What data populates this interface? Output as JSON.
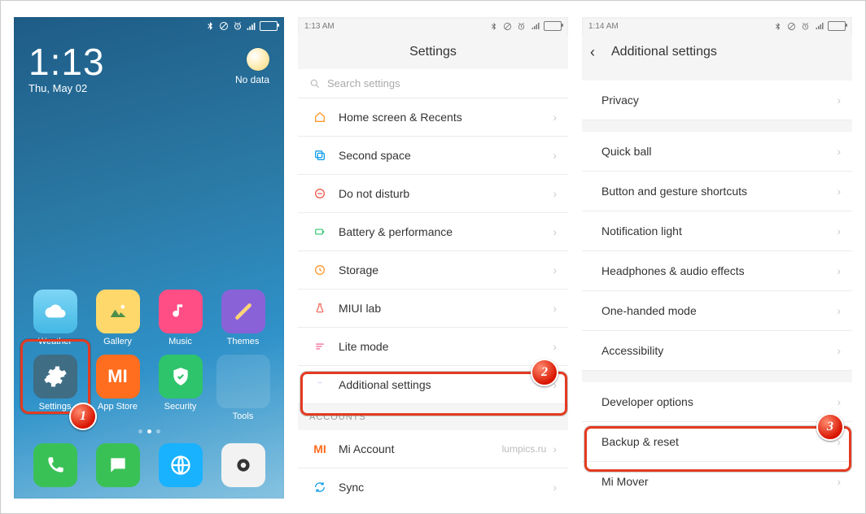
{
  "phone1": {
    "status": {
      "icons": [
        "bt",
        "dnd",
        "alarm",
        "signal",
        "battery"
      ]
    },
    "clock_time": "1:13",
    "clock_date": "Thu, May 02",
    "weather_status": "No data",
    "apps_row1": [
      {
        "name": "weather",
        "label": "Weather",
        "bg": "#56c4ec"
      },
      {
        "name": "gallery",
        "label": "Gallery",
        "bg": "#ffd86b"
      },
      {
        "name": "music",
        "label": "Music",
        "bg": "#ff4d86"
      },
      {
        "name": "themes",
        "label": "Themes",
        "bg": "#8a62d8"
      }
    ],
    "apps_row2": [
      {
        "name": "settings",
        "label": "Settings",
        "bg": "#3e6d84"
      },
      {
        "name": "appstore",
        "label": "App Store",
        "bg": "#ff6d1f"
      },
      {
        "name": "security",
        "label": "Security",
        "bg": "#2ec46b"
      },
      {
        "name": "tools",
        "label": "Tools",
        "bg": "rgba(255,255,255,.1)"
      }
    ],
    "dock": [
      {
        "name": "phone",
        "bg": "#3ac156"
      },
      {
        "name": "messages",
        "bg": "#3ac156"
      },
      {
        "name": "browser",
        "bg": "#19b2ff"
      },
      {
        "name": "camera",
        "bg": "#f2f2f2"
      }
    ],
    "highlight_badge": "1"
  },
  "phone2": {
    "status_time": "1:13 AM",
    "title": "Settings",
    "search_placeholder": "Search settings",
    "items": [
      {
        "icon": "home",
        "label": "Home screen & Recents"
      },
      {
        "icon": "second",
        "label": "Second space"
      },
      {
        "icon": "dnd",
        "label": "Do not disturb"
      },
      {
        "icon": "batt",
        "label": "Battery & performance"
      },
      {
        "icon": "storage",
        "label": "Storage"
      },
      {
        "icon": "lab",
        "label": "MIUI lab"
      },
      {
        "icon": "lite",
        "label": "Lite mode"
      },
      {
        "icon": "more",
        "label": "Additional settings"
      }
    ],
    "section_accounts": "ACCOUNTS",
    "mi_account": {
      "label": "Mi Account",
      "value": "lumpics.ru"
    },
    "sync": {
      "label": "Sync"
    },
    "highlight_badge": "2"
  },
  "phone3": {
    "status_time": "1:14 AM",
    "title": "Additional  settings",
    "items_a": [
      {
        "label": "Privacy"
      },
      {
        "label": "Quick ball"
      },
      {
        "label": "Button and gesture shortcuts"
      },
      {
        "label": "Notification light"
      },
      {
        "label": "Headphones & audio effects"
      },
      {
        "label": "One-handed mode"
      },
      {
        "label": "Accessibility"
      }
    ],
    "items_b": [
      {
        "label": "Developer options"
      },
      {
        "label": "Backup & reset"
      },
      {
        "label": "Mi Mover"
      }
    ],
    "highlight_badge": "3"
  }
}
